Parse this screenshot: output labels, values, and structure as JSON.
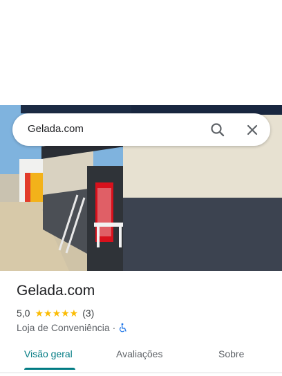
{
  "search": {
    "query": "Gelada.com"
  },
  "place": {
    "name": "Gelada.com",
    "rating": "5,0",
    "stars": "★★★★★",
    "review_count": "(3)",
    "category": "Loja de Conveniência",
    "separator": "·"
  },
  "tabs": [
    {
      "label": "Visão geral"
    },
    {
      "label": "Avaliações"
    },
    {
      "label": "Sobre"
    }
  ],
  "colors": {
    "accent": "#017b83",
    "star": "#fbbc04"
  }
}
